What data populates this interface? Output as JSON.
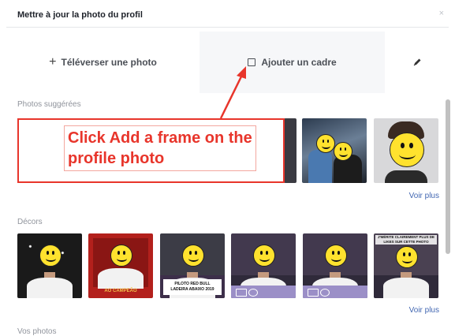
{
  "dialog": {
    "title": "Mettre à jour la photo du profil",
    "close_symbol": "×"
  },
  "actions": {
    "upload_label": "Téléverser une photo",
    "upload_icon": "plus-icon",
    "frame_label": "Ajouter un cadre",
    "frame_icon": "frame-icon",
    "edit_icon": "pencil-icon"
  },
  "suggested": {
    "label": "Photos suggérées",
    "see_more": "Voir plus"
  },
  "frames": {
    "label": "Décors",
    "see_more": "Voir plus",
    "items": [
      {
        "caption": ""
      },
      {
        "caption": "AO CAMPEÃO"
      },
      {
        "caption": "PILOTO RED BULL\nLADEIRA ABAIXO 2019"
      },
      {
        "caption": ""
      },
      {
        "caption": ""
      },
      {
        "caption": "J'MÉRITE CLAIREMENT PLUS DE LIKES SUR CETTE PHOTO"
      }
    ]
  },
  "your_photos": {
    "label": "Vos photos"
  },
  "annotation": {
    "text": "Click Add a frame on the profile photo",
    "color": "#e8352b"
  },
  "colors": {
    "link": "#4267b2",
    "smiley": "#ffe22e"
  }
}
